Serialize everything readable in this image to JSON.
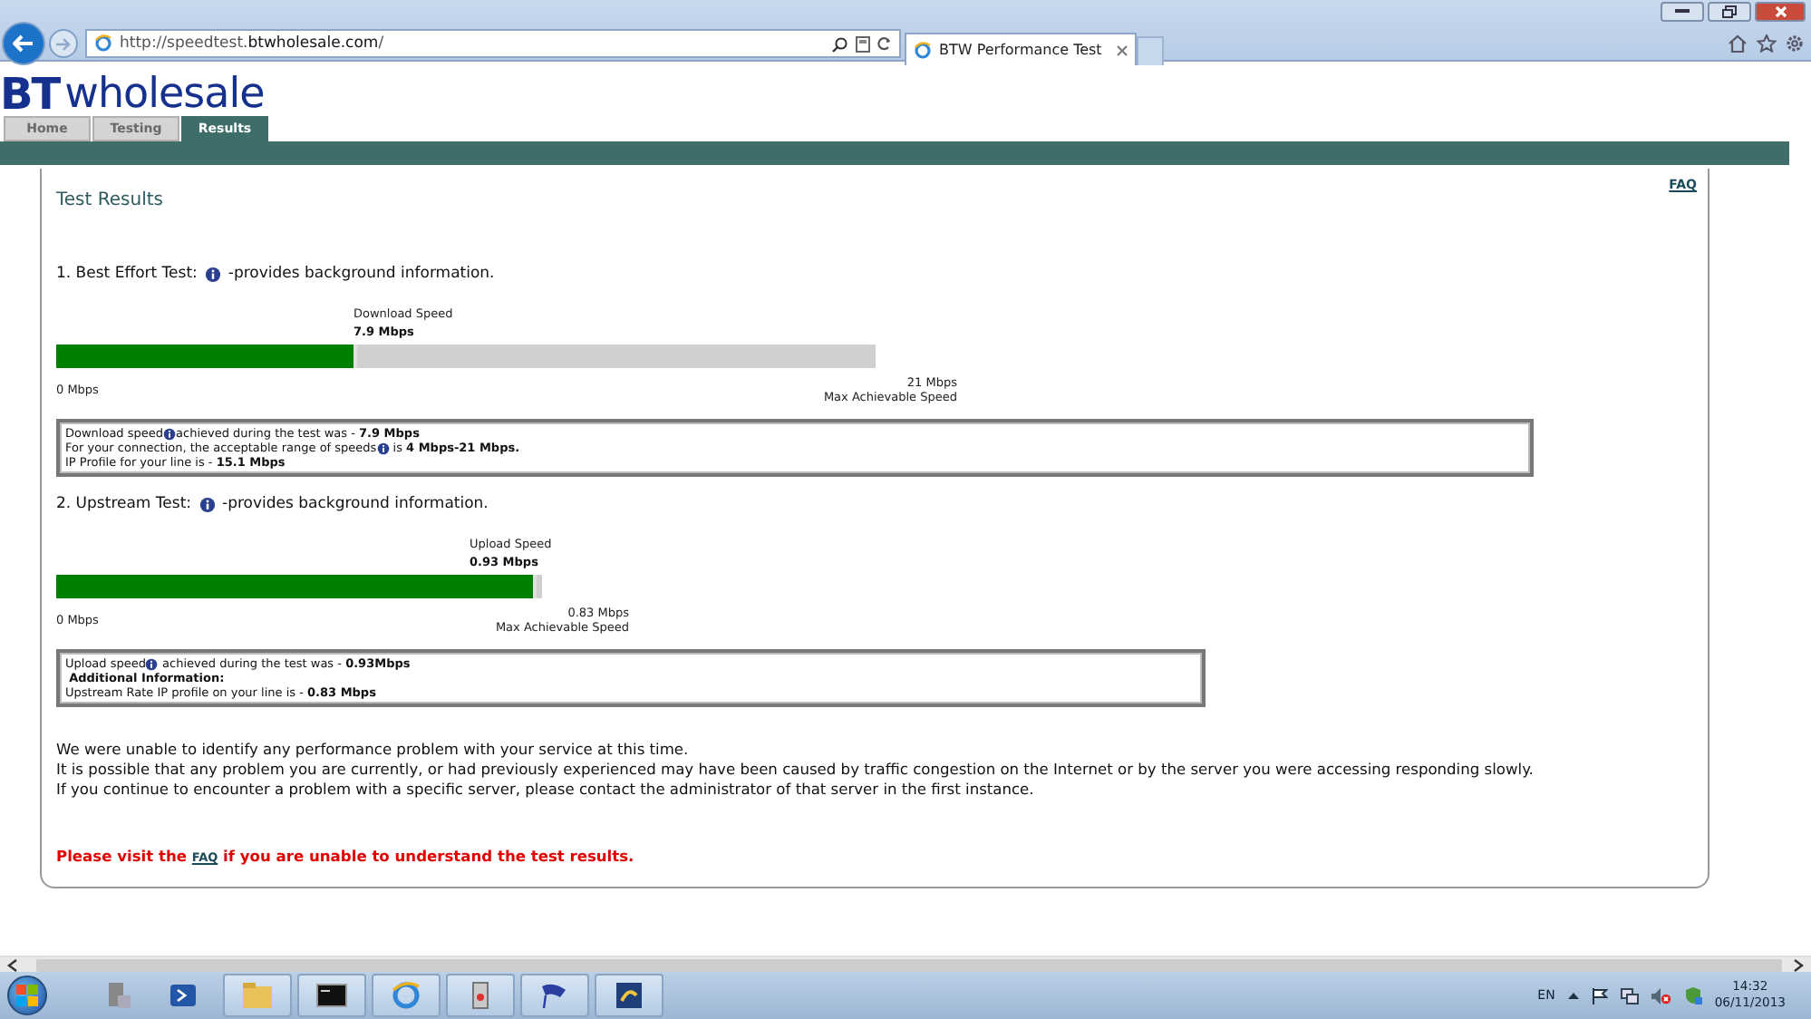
{
  "browser": {
    "address": "http://speedtest.**btwholesale.com**/",
    "tab_title": "BTW Performance Test"
  },
  "site": {
    "logo_mark": "BT",
    "logo_name": "wholesale",
    "nav": [
      {
        "label": "Home",
        "selected": false
      },
      {
        "label": "Testing",
        "selected": false
      },
      {
        "label": "Results",
        "selected": true
      }
    ]
  },
  "results": {
    "title": "Test Results",
    "faq_link": "FAQ",
    "tests": [
      {
        "heading_before": "1. Best Effort Test:",
        "heading_after": "-provides background information.",
        "caption": "Download  Speed",
        "speed": "7.9 Mbps",
        "level": 0.368,
        "min": "0 Mbps",
        "max": "21 Mbps",
        "max_label": "Max Achievable Speed",
        "info": [
          {
            "before": "Download speed",
            "after": "achieved during the test was - **7.9 Mbps**"
          },
          {
            "before": "For your connection, the acceptable range of speeds",
            "after": " is **4 Mbps-21 Mbps.**"
          },
          {
            "before": "IP Profile for your line is - **15.1 Mbps**"
          }
        ]
      },
      {
        "heading_before": "2. Upstream Test:",
        "heading_after": "-provides background information.",
        "caption": "Upload Speed",
        "speed": "0.93 Mbps",
        "level": 0.99,
        "min": "0 Mbps",
        "max": "0.83 Mbps",
        "max_label": "Max Achievable Speed",
        "info": [
          {
            "before": "Upload speed",
            "after": " achieved during the test was - **0.93Mbps**"
          },
          {
            "before": " **Additional Information:**"
          },
          {
            "before": "Upstream Rate IP profile on your line is - **0.83 Mbps**"
          }
        ]
      }
    ],
    "summary": [
      "We were unable to identify any performance problem with your service at this time.",
      "It is possible that any problem you are currently, or had previously experienced may have been caused by traffic congestion on the Internet or by the server you were accessing responding slowly.",
      "If you continue to encounter a problem with a specific server, please contact the administrator of that server in the first instance."
    ],
    "notice": {
      "before": "Please visit the",
      "link": "FAQ",
      "after": "if you are unable to understand the test results."
    }
  },
  "taskbar": {
    "language": "EN",
    "time": "14:32",
    "date": "06/11/2013"
  }
}
